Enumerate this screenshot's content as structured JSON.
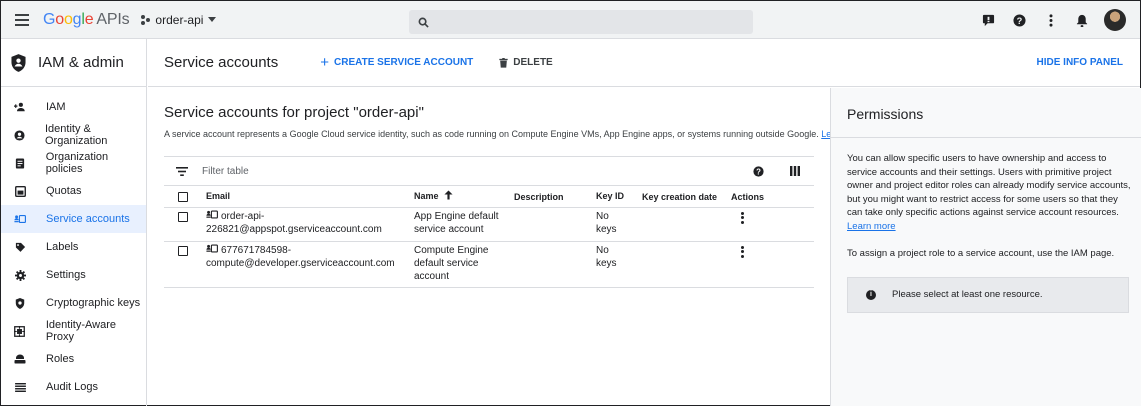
{
  "topbar": {
    "logo_google": [
      "G",
      "o",
      "o",
      "g",
      "l",
      "e"
    ],
    "logo_suffix": "APIs",
    "project": "order-api",
    "search_placeholder": ""
  },
  "sidebar": {
    "title": "IAM & admin",
    "items": [
      {
        "label": "IAM",
        "icon": "person-add-icon"
      },
      {
        "label": "Identity & Organization",
        "icon": "account-circle-icon"
      },
      {
        "label": "Organization policies",
        "icon": "policy-doc-icon"
      },
      {
        "label": "Quotas",
        "icon": "quota-icon"
      },
      {
        "label": "Service accounts",
        "icon": "service-account-icon",
        "active": true
      },
      {
        "label": "Labels",
        "icon": "label-icon"
      },
      {
        "label": "Settings",
        "icon": "gear-icon"
      },
      {
        "label": "Cryptographic keys",
        "icon": "shield-icon"
      },
      {
        "label": "Identity-Aware Proxy",
        "icon": "proxy-icon"
      },
      {
        "label": "Roles",
        "icon": "roles-icon"
      },
      {
        "label": "Audit Logs",
        "icon": "list-icon"
      }
    ]
  },
  "header": {
    "title": "Service accounts",
    "create_label": "CREATE SERVICE ACCOUNT",
    "delete_label": "DELETE",
    "hide_info_label": "HIDE INFO PANEL"
  },
  "main": {
    "heading": "Service accounts for project \"order-api\"",
    "description": "A service account represents a Google Cloud service identity, such as code running on Compute Engine VMs, App Engine apps, or systems running outside Google.",
    "learn_more": "Learn more",
    "filter_label": "Filter table",
    "columns": {
      "email": "Email",
      "name": "Name",
      "description": "Description",
      "key_id": "Key ID",
      "key_date": "Key creation date",
      "actions": "Actions"
    },
    "rows": [
      {
        "email_line1": "order-api-",
        "email_line2": "226821@appspot.gserviceaccount.com",
        "name_line1": "App Engine default",
        "name_line2": "service account",
        "name_line3": "",
        "key_line1": "No",
        "key_line2": "keys"
      },
      {
        "email_line1": "677671784598-",
        "email_line2": "compute@developer.gserviceaccount.com",
        "name_line1": "Compute Engine",
        "name_line2": "default service",
        "name_line3": "account",
        "key_line1": "No",
        "key_line2": "keys"
      }
    ]
  },
  "info_panel": {
    "title": "Permissions",
    "para1": "You can allow specific users to have ownership and access to service accounts and their settings. Users with primitive project owner and project editor roles can already modify service accounts, but you might want to restrict access for some users so that they can take only specific actions against service account resources.",
    "learn_more": "Learn more",
    "para2": "To assign a project role to a service account, use the IAM page.",
    "notice": "Please select at least one resource."
  },
  "colors": {
    "accent": "#1a73e8",
    "active_bg": "#e8f0fe",
    "topbar_bg": "#f1f3f4"
  }
}
